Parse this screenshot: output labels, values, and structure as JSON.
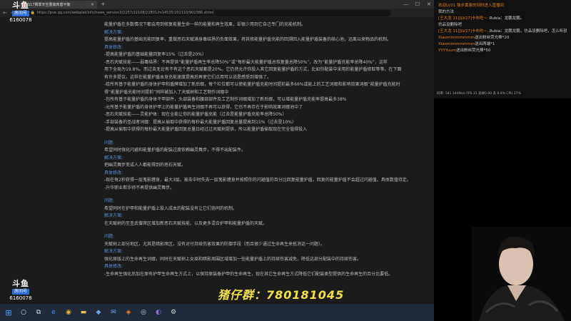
{
  "browser": {
    "tab_title": "S17赛季天空重装肉盾平衡",
    "tab_close": "✕",
    "new_tab": "+",
    "url": "https://pve.qq.com/webplat/info/news_version3/2257/22108/22801/m14535/202110/902386.shtml",
    "window_controls": [
      "—",
      "☐",
      "✕"
    ]
  },
  "article": [
    {
      "kind": "text",
      "text": "能量护盾在多数情况下都会用到修复能量生命一样的能量和再生效果，却很少用到它自己专门的充能机制。"
    },
    {
      "kind": "label",
      "text": "解决方案:"
    },
    {
      "kind": "text",
      "text": "提高能量护盾的基础充能回复率，重做恶石天赋满身毒结界的负面效果，将其修能量护盾充能的回溯回入能量护盾装备的核心池，远离以来物品的机制。"
    },
    {
      "kind": "label",
      "text": "具体修改:"
    },
    {
      "kind": "text",
      "text": "-提高能量护盾的基础能量回复率15%（过去是20%）"
    },
    {
      "kind": "text",
      "text": "-恶石天赋技能——弱毒结界：不再提供“能量护盾再生率总降50%”或“每秒最大能量护盾总恢复量总降50%”，改为“能量护盾充能率总降40%”，这样"
    },
    {
      "kind": "text",
      "text": "用下全局为19.8%。而过去无论有不有这个恶石天赋都是20%。它仍然允许你投入其它回复能量护盾的方式，比如你配装中采用的能量护盾修取等等。在下面"
    },
    {
      "kind": "text",
      "text": "有许多提议，这样在能量护盾本身充能速度提高后再使它们点用可以说是感受到增强了。"
    },
    {
      "kind": "text",
      "text": "-给所有基于能量护盾的身体护甲和盾牌增加了新后缀，每个栏位都可以使能量护盾充能时间提前最多66%或能上的工艺词缀和影响效果词缀“能量护盾充能时"
    },
    {
      "kind": "text",
      "text": "得“能量护盾充能时间提前”同样被加入了天赋树和工艺制作词缀中"
    },
    {
      "kind": "text",
      "text": "-包所有基于能量护盾的身体干甲部件，头部装备和腰部部件及工艺制作词缀增加了新后缀，可以增能量护盾充能率提高最多38%"
    },
    {
      "kind": "text",
      "text": "-元所基于能量护盾的身体护甲上的能量护盾再生词缀不再可以获得，它也不再存在于影响效果词缀池中了"
    },
    {
      "kind": "text",
      "text": "-恶石天赋技能——灵能护体：现在全能让你的能量护盾充能（过去是能量护盾充能率总降50%）"
    },
    {
      "kind": "text",
      "text": "-手部装备的圣战者词缀：提高从偷取中获得的每秒最大能量护盾回复总量提高到15%（过去是10%）"
    },
    {
      "kind": "text",
      "text": "-提高从偷取中获得的每秒最大能量护盾回复总量日经过过天赋树提供，所以能量护盾偷取现在完全值得投入"
    },
    {
      "kind": "gap"
    },
    {
      "kind": "label",
      "text": "问题:"
    },
    {
      "kind": "text",
      "text": "希望同时强化闪避和能量护盾的配装过度依赖幽灵舞步，不得不出配装件。"
    },
    {
      "kind": "label",
      "text": "解决方案:"
    },
    {
      "kind": "text",
      "text": "把幽灵舞步变成人人都能得到的恶石天赋。"
    },
    {
      "kind": "label",
      "text": "具体修改:"
    },
    {
      "kind": "text",
      "text": "-现在每2秒获得一层鬼影缠身，最大3层。被击中时失去一层鬼影缠身并按照你的闪避值的百分比回复能量护盾。回复的能量护盾不会超过闪避值。具体数值待定。"
    },
    {
      "kind": "text",
      "text": "-升华职业欺诈师不再提供幽灵舞步。"
    },
    {
      "kind": "gap"
    },
    {
      "kind": "label",
      "text": "问题:"
    },
    {
      "kind": "text",
      "text": "希望同时在护甲和能量护盾上投入成本的配装没有让它们协同的机制。"
    },
    {
      "kind": "label",
      "text": "解决方案:"
    },
    {
      "kind": "text",
      "text": "在天赋树的至圣武僧席区增加新恶石天赋技能，以及更多混合护甲和能量护盾的天赋。"
    },
    {
      "kind": "gap"
    },
    {
      "kind": "label",
      "text": "问题:"
    },
    {
      "kind": "text",
      "text": "天赋树上部分地区，尤其是暗影席区，没有对付持续伤害效果的防御手段（而且很少通过生命再生来抵消这一问题）。"
    },
    {
      "kind": "label",
      "text": "解决方案:"
    },
    {
      "kind": "text",
      "text": "强化原版上的生命再生词缀，同时在天赋树上女巫和暗影周围区域增加一些能量护盾上的持续伤害减免，降低这部分配装中的持续伤害。"
    },
    {
      "kind": "label",
      "text": "具体修改:"
    },
    {
      "kind": "text",
      "text": "-生命再生强化后加在原有护甲生命再生方式上，以保持原装备护甲的生命再生，现在其它生命再生方式降低它们配装类型提供的生命再生的百分比要低。"
    }
  ],
  "watermark": {
    "logo_text": "斗鱼",
    "sub_text": "房间号",
    "room_number": "6160078"
  },
  "overlay_text": "猪仔群：780181045",
  "chat": [
    {
      "user": "欢迎LV21 独步黄泉的到时进入直播间",
      "text": ""
    },
    {
      "user": "",
      "text": "我的方法"
    },
    {
      "user": "[王大龙 11][LV27]卡布吃~:",
      "text": " Rubia：龙鹏龙鹏。"
    },
    {
      "user": "",
      "text": "仿品设删除吧"
    },
    {
      "user": "[王大龙 11][LV27]卡布吃~:",
      "text": " Rubia：龙鹏龙鹏，仿品设删除吧，怎么听就要金币收礼。"
    },
    {
      "user": "Xiaomimmmmmm",
      "text": "送出粉丝荧光棒*20"
    },
    {
      "user": "Xiaomimmmmmm",
      "text": "送出两端*1"
    },
    {
      "user": "YYYYuum",
      "text": "送出粉丝荧光棒*50"
    }
  ],
  "stats_text": "码率: 541  1449k/s  FPS 31  丢帧0.00  丢 0.0%  CPU 27%",
  "taskbar": {
    "icons": [
      "start-icon",
      "search-icon",
      "task-view-icon",
      "edge-icon",
      "chrome-icon",
      "explorer-icon",
      "store-icon",
      "mail-icon",
      "douyu-icon",
      "obs-icon",
      "game-icon",
      "settings-icon"
    ],
    "icon_glyphs": [
      "⊞",
      "○",
      "⧉",
      "e",
      "◉",
      "▬",
      "◆",
      "✉",
      "◈",
      "◎",
      "◐",
      "⚙"
    ],
    "icon_colors": [
      "#4ea3f5",
      "#ddd",
      "#ddd",
      "#3b8ee6",
      "#e8b437",
      "#e8c15a",
      "#6aa3e6",
      "#6aa3e6",
      "#f2811d",
      "#cfcfcf",
      "#9c6ae6",
      "#ddd"
    ]
  }
}
